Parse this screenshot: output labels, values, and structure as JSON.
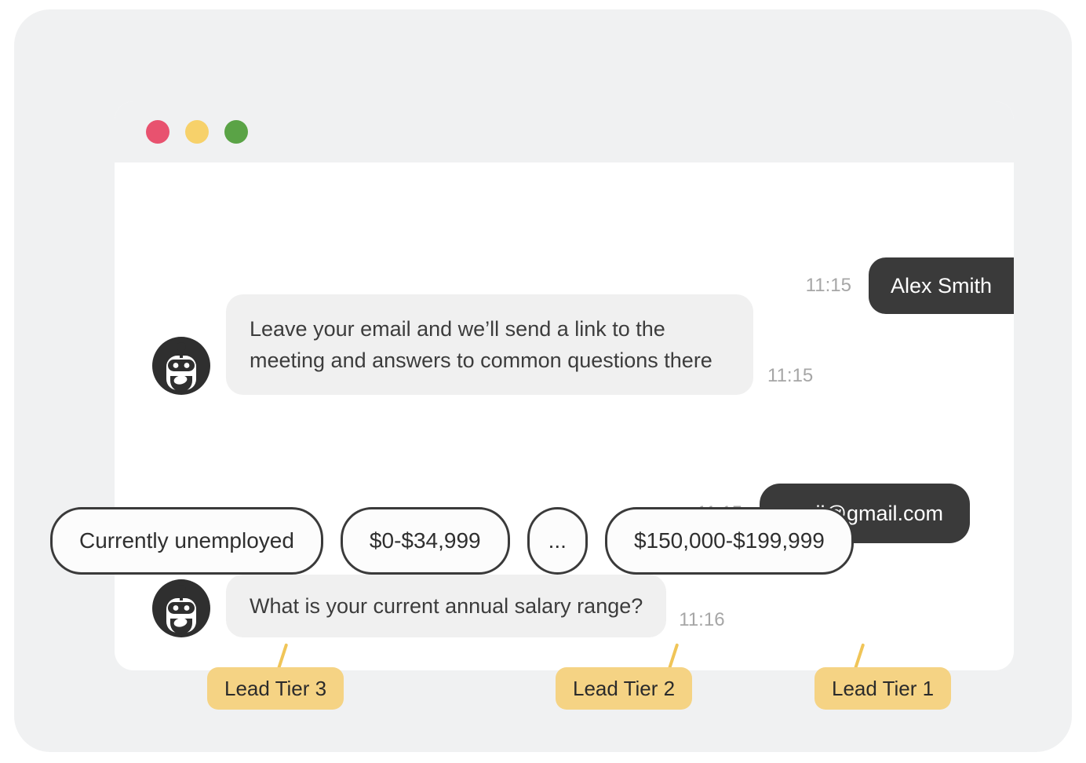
{
  "window": {
    "traffic_lights": [
      {
        "name": "close",
        "color": "#e8526f"
      },
      {
        "name": "minimize",
        "color": "#f7d16a"
      },
      {
        "name": "maximize",
        "color": "#5aa346"
      }
    ]
  },
  "conversation": {
    "messages": [
      {
        "id": "m1",
        "sender": "user",
        "sender_name": "Alex Smith",
        "text": "Alex Smith",
        "time": "11:15"
      },
      {
        "id": "m2",
        "sender": "bot",
        "avatar_icon": "robot-avatar-icon",
        "text": "Leave your email and we’ll send a link to the meeting and answers to common questions there",
        "time": "11:15"
      },
      {
        "id": "m3",
        "sender": "user",
        "text": "mail@gmail.com",
        "time": "11:15"
      },
      {
        "id": "m4",
        "sender": "bot",
        "avatar_icon": "robot-avatar-icon",
        "text": "What is your current annual salary range?",
        "time": "11:16"
      }
    ]
  },
  "quick_replies": [
    {
      "id": "qr1",
      "label": "Currently unemployed"
    },
    {
      "id": "qr2",
      "label": "$0-$34,999"
    },
    {
      "id": "qr3",
      "label": "..."
    },
    {
      "id": "qr4",
      "label": "$150,000-$199,999"
    }
  ],
  "annotations": [
    {
      "id": "t3",
      "label": "Lead Tier 3",
      "target": "qr1"
    },
    {
      "id": "t2",
      "label": "Lead Tier 2",
      "target": "qr3"
    },
    {
      "id": "t1",
      "label": "Lead Tier 1",
      "target": "qr4"
    }
  ],
  "colors": {
    "stage_bg": "#f0f1f2",
    "card_bg": "#ffffff",
    "bot_bubble": "#f0f0f0",
    "user_bubble": "#3a3a3a",
    "badge_bg": "#f5d384",
    "connector": "#f0c558",
    "timestamp": "#a6a6a6",
    "chip_border": "#3a3a3a"
  }
}
